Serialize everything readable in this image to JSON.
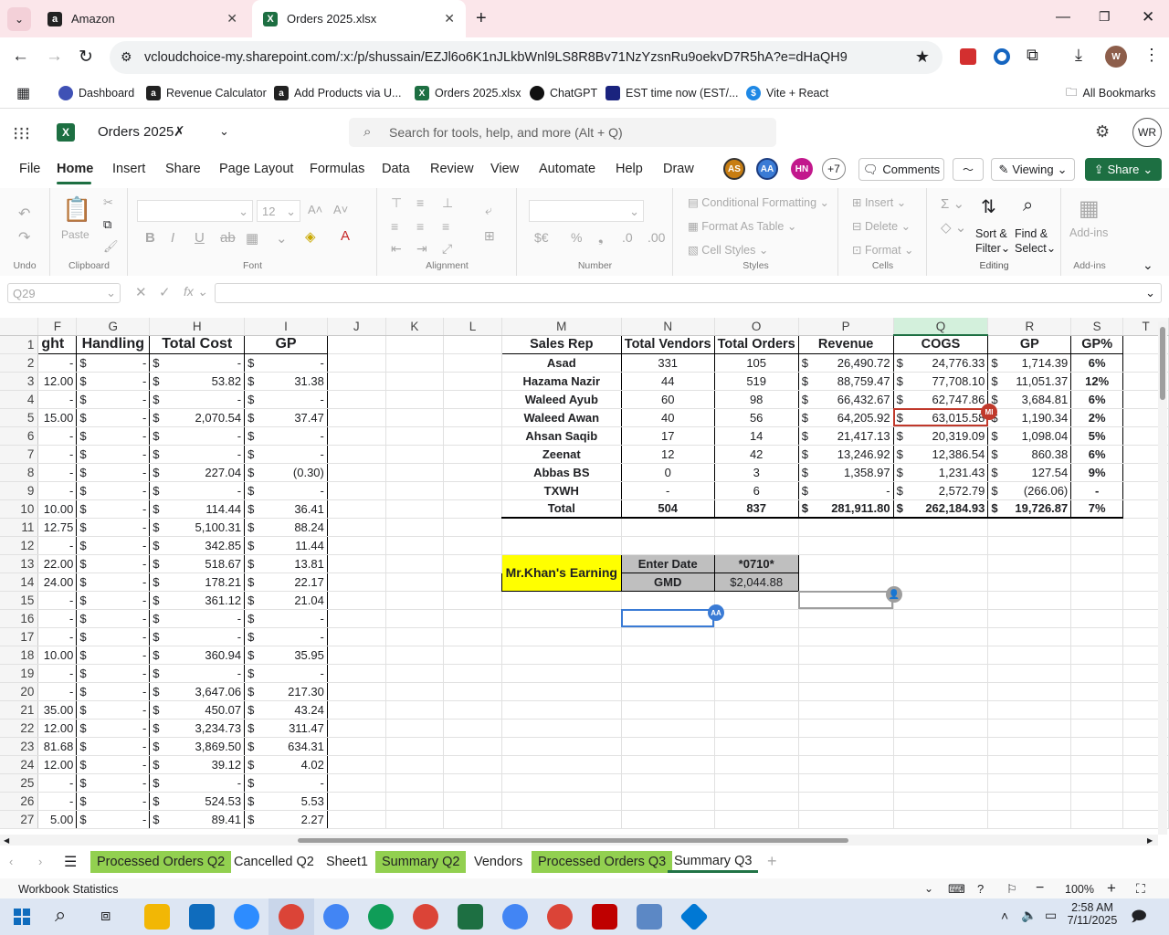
{
  "browser": {
    "tabs": [
      {
        "label": "Amazon",
        "icon": "amazon-icon"
      },
      {
        "label": "Orders 2025.xlsx",
        "icon": "excel-icon"
      }
    ],
    "url": "vcloudchoice-my.sharepoint.com/:x:/p/shussain/EZJl6o6K1nJLkbWnl9LS8R8Bv71NzYzsnRu9oekvD7R5hA?e=dHaQH9",
    "bookmarks": [
      "Dashboard",
      "Revenue Calculator",
      "Add Products via U...",
      "Orders 2025.xlsx",
      "ChatGPT",
      "EST time now (EST/...",
      "Vite + React"
    ],
    "all_bookmarks": "All Bookmarks",
    "profile": "W"
  },
  "excel": {
    "doc_title": "Orders 2025",
    "search_placeholder": "Search for tools, help, and more (Alt + Q)",
    "user_initials": "WR",
    "menu": [
      "File",
      "Home",
      "Insert",
      "Share",
      "Page Layout",
      "Formulas",
      "Data",
      "Review",
      "View",
      "Automate",
      "Help",
      "Draw"
    ],
    "collaborators": [
      {
        "initials": "AS",
        "color": "#c77d12"
      },
      {
        "initials": "AA",
        "color": "#3a7bd5"
      },
      {
        "initials": "HN",
        "color": "#c2188c"
      }
    ],
    "more_collab": "+7",
    "comments": "Comments",
    "viewing": "Viewing",
    "share": "Share",
    "ribbon": {
      "undo_group": "Undo",
      "clipboard": "Clipboard",
      "paste": "Paste",
      "font": "Font",
      "font_size": "12",
      "alignment": "Alignment",
      "number": "Number",
      "conditional": "Conditional Formatting",
      "format_table": "Format As Table",
      "cell_styles": "Cell Styles",
      "styles": "Styles",
      "insert": "Insert",
      "delete": "Delete",
      "format": "Format",
      "cells": "Cells",
      "sort": "Sort &",
      "filter": "Filter",
      "find": "Find &",
      "select": "Select",
      "editing": "Editing",
      "addins": "Add-ins",
      "addins_group": "Add-ins"
    },
    "name_box": "Q29",
    "columns": [
      "F",
      "G",
      "H",
      "I",
      "J",
      "K",
      "L",
      "M",
      "N",
      "O",
      "P",
      "Q",
      "R",
      "S",
      "T"
    ],
    "left_table": {
      "headers": [
        "ght",
        "Handling",
        "Total Cost",
        "GP"
      ],
      "rows": [
        [
          "-",
          "-",
          "-",
          "-"
        ],
        [
          "12.00",
          "-",
          "53.82",
          "31.38"
        ],
        [
          "-",
          "-",
          "-",
          "-"
        ],
        [
          "15.00",
          "-",
          "2,070.54",
          "37.47"
        ],
        [
          "-",
          "-",
          "-",
          "-"
        ],
        [
          "-",
          "-",
          "-",
          "-"
        ],
        [
          "-",
          "-",
          "227.04",
          "(0.30)"
        ],
        [
          "-",
          "-",
          "-",
          "-"
        ],
        [
          "10.00",
          "-",
          "114.44",
          "36.41"
        ],
        [
          "12.75",
          "-",
          "5,100.31",
          "88.24"
        ],
        [
          "-",
          "-",
          "342.85",
          "11.44"
        ],
        [
          "22.00",
          "-",
          "518.67",
          "13.81"
        ],
        [
          "24.00",
          "-",
          "178.21",
          "22.17"
        ],
        [
          "-",
          "-",
          "361.12",
          "21.04"
        ],
        [
          "-",
          "-",
          "-",
          "-"
        ],
        [
          "-",
          "-",
          "-",
          "-"
        ],
        [
          "10.00",
          "-",
          "360.94",
          "35.95"
        ],
        [
          "-",
          "-",
          "-",
          "-"
        ],
        [
          "-",
          "-",
          "3,647.06",
          "217.30"
        ],
        [
          "35.00",
          "-",
          "450.07",
          "43.24"
        ],
        [
          "12.00",
          "-",
          "3,234.73",
          "311.47"
        ],
        [
          "81.68",
          "-",
          "3,869.50",
          "634.31"
        ],
        [
          "12.00",
          "-",
          "39.12",
          "4.02"
        ],
        [
          "-",
          "-",
          "-",
          "-"
        ],
        [
          "-",
          "-",
          "524.53",
          "5.53"
        ],
        [
          "5.00",
          "-",
          "89.41",
          "2.27"
        ]
      ]
    },
    "summary": {
      "headers": [
        "Sales Rep",
        "Total Vendors",
        "Total Orders",
        "Revenue",
        "COGS",
        "GP",
        "GP%"
      ],
      "rows": [
        [
          "Asad",
          "331",
          "105",
          "26,490.72",
          "24,776.33",
          "1,714.39",
          "6%"
        ],
        [
          "Hazama Nazir",
          "44",
          "519",
          "88,759.47",
          "77,708.10",
          "11,051.37",
          "12%"
        ],
        [
          "Waleed Ayub",
          "60",
          "98",
          "66,432.67",
          "62,747.86",
          "3,684.81",
          "6%"
        ],
        [
          "Waleed Awan",
          "40",
          "56",
          "64,205.92",
          "63,015.58",
          "1,190.34",
          "2%"
        ],
        [
          "Ahsan Saqib",
          "17",
          "14",
          "21,417.13",
          "20,319.09",
          "1,098.04",
          "5%"
        ],
        [
          "Zeenat",
          "12",
          "42",
          "13,246.92",
          "12,386.54",
          "860.38",
          "6%"
        ],
        [
          "Abbas BS",
          "0",
          "3",
          "1,358.97",
          "1,231.43",
          "127.54",
          "9%"
        ],
        [
          "TXWH",
          "-",
          "6",
          "-",
          "2,572.79",
          "(266.06)",
          "-"
        ],
        [
          "Total",
          "504",
          "837",
          "281,911.80",
          "262,184.93",
          "19,726.87",
          "7%"
        ]
      ]
    },
    "earning": {
      "label": "Mr.Khan's Earning",
      "enter_date": "Enter Date",
      "date_value": "*0710*",
      "gmd": "GMD",
      "gmd_value": "$2,044.88"
    },
    "presence": [
      {
        "initials": "MI",
        "color": "#c0392b"
      },
      {
        "initials": "AA",
        "color": "#3a7bd5"
      }
    ],
    "sheet_tabs": [
      {
        "label": "Processed Orders Q2",
        "green": true
      },
      {
        "label": "Cancelled Q2",
        "green": false
      },
      {
        "label": "Sheet1",
        "green": false
      },
      {
        "label": "Summary Q2",
        "green": true
      },
      {
        "label": "Vendors",
        "green": false
      },
      {
        "label": "Processed Orders Q3",
        "green": true
      },
      {
        "label": "Summary Q3",
        "green": false,
        "active": true
      }
    ],
    "status": "Workbook Statistics",
    "zoom": "100%"
  },
  "taskbar": {
    "time": "2:58 AM",
    "date": "7/11/2025"
  }
}
